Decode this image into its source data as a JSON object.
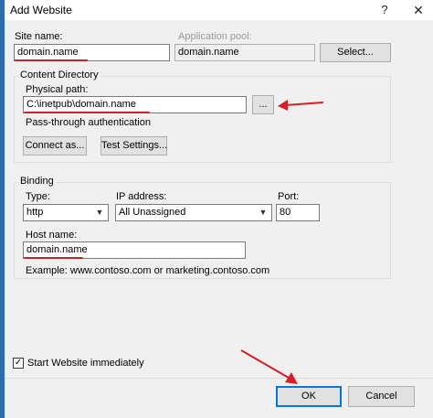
{
  "window": {
    "title": "Add Website",
    "help_glyph": "?",
    "close_glyph": "✕"
  },
  "site": {
    "site_name_label": "Site name:",
    "site_name_value": "domain.name",
    "app_pool_label": "Application pool:",
    "app_pool_value": "domain.name",
    "select_button": "Select..."
  },
  "content_directory": {
    "group_label": "Content Directory",
    "physical_path_label": "Physical path:",
    "physical_path_value": "C:\\inetpub\\domain.name",
    "browse_button": "...",
    "passthrough_label": "Pass-through authentication",
    "connect_as_button": "Connect as...",
    "test_settings_button": "Test Settings..."
  },
  "binding": {
    "group_label": "Binding",
    "type_label": "Type:",
    "type_value": "http",
    "ip_label": "IP address:",
    "ip_value": "All Unassigned",
    "port_label": "Port:",
    "port_value": "80",
    "host_label": "Host name:",
    "host_value": "domain.name",
    "example_text": "Example: www.contoso.com or marketing.contoso.com"
  },
  "start": {
    "checkbox_label": "Start Website immediately",
    "checked": true,
    "check_glyph": "✓"
  },
  "footer": {
    "ok_button": "OK",
    "cancel_button": "Cancel"
  },
  "annotation_color": "#d0202a"
}
